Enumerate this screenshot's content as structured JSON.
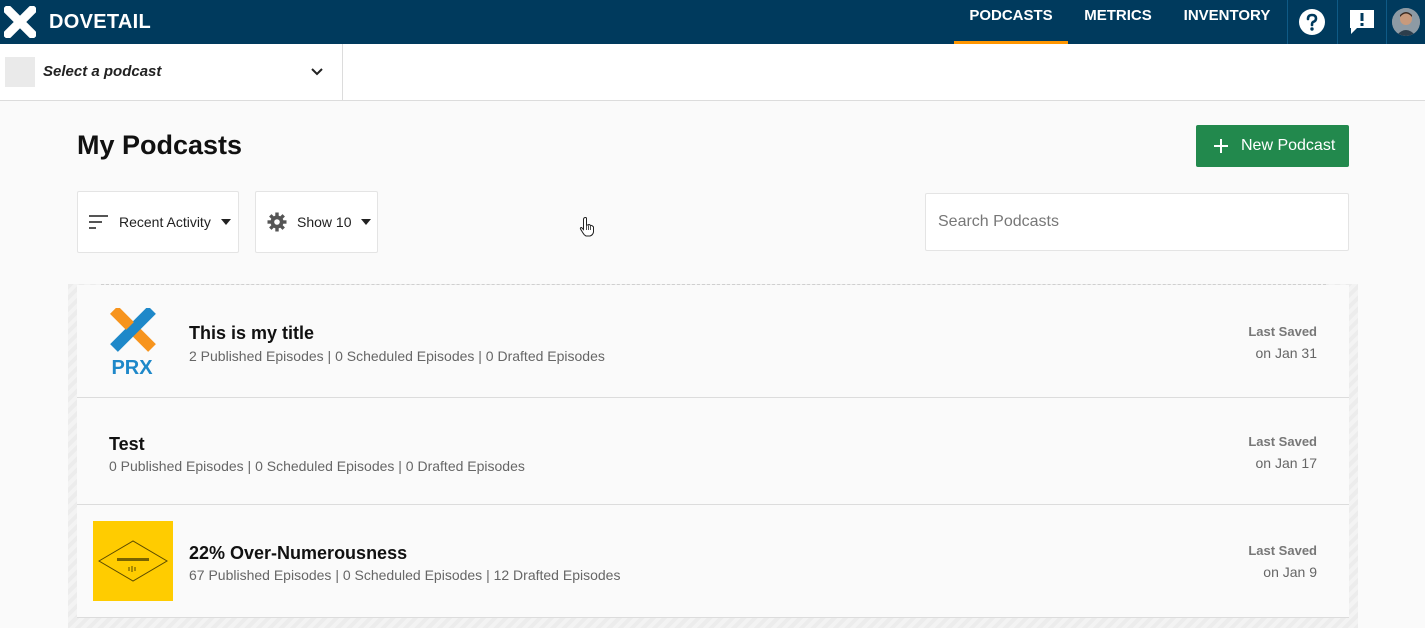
{
  "brand": {
    "name": "DOVETAIL"
  },
  "nav": {
    "links": [
      {
        "label": "PODCASTS",
        "active": true
      },
      {
        "label": "METRICS",
        "active": false
      },
      {
        "label": "INVENTORY",
        "active": false
      }
    ],
    "icons": [
      "help-icon",
      "feedback-icon",
      "user-avatar"
    ]
  },
  "podcast_select": {
    "label": "Select a podcast",
    "icon": "chevron-down-icon"
  },
  "page": {
    "title": "My Podcasts",
    "new_button": "New Podcast"
  },
  "controls": {
    "sort_label": "Recent Activity",
    "show_label": "Show 10",
    "search_placeholder": "Search Podcasts"
  },
  "podcasts": [
    {
      "title": "This is my title",
      "stats": "2 Published Episodes | 0 Scheduled Episodes | 0 Drafted Episodes",
      "saved_label": "Last Saved",
      "saved_date": "on Jan 31",
      "thumb": "prx-logo",
      "thumb_text": "PRX"
    },
    {
      "title": "Test",
      "stats": "0 Published Episodes | 0 Scheduled Episodes | 0 Drafted Episodes",
      "saved_label": "Last Saved",
      "saved_date": "on Jan 17",
      "thumb": null
    },
    {
      "title": "22% Over-Numerousness",
      "stats": "67 Published Episodes | 0 Scheduled Episodes | 12 Drafted Episodes",
      "saved_label": "Last Saved",
      "saved_date": "on Jan 9",
      "thumb": "yellow-podcast-art"
    }
  ],
  "colors": {
    "topbar": "#003a5d",
    "active_underline": "#ff9600",
    "primary_button": "#22894d",
    "prx_orange": "#f7941d",
    "prx_blue": "#1e88c9",
    "art_yellow": "#ffcc00"
  }
}
